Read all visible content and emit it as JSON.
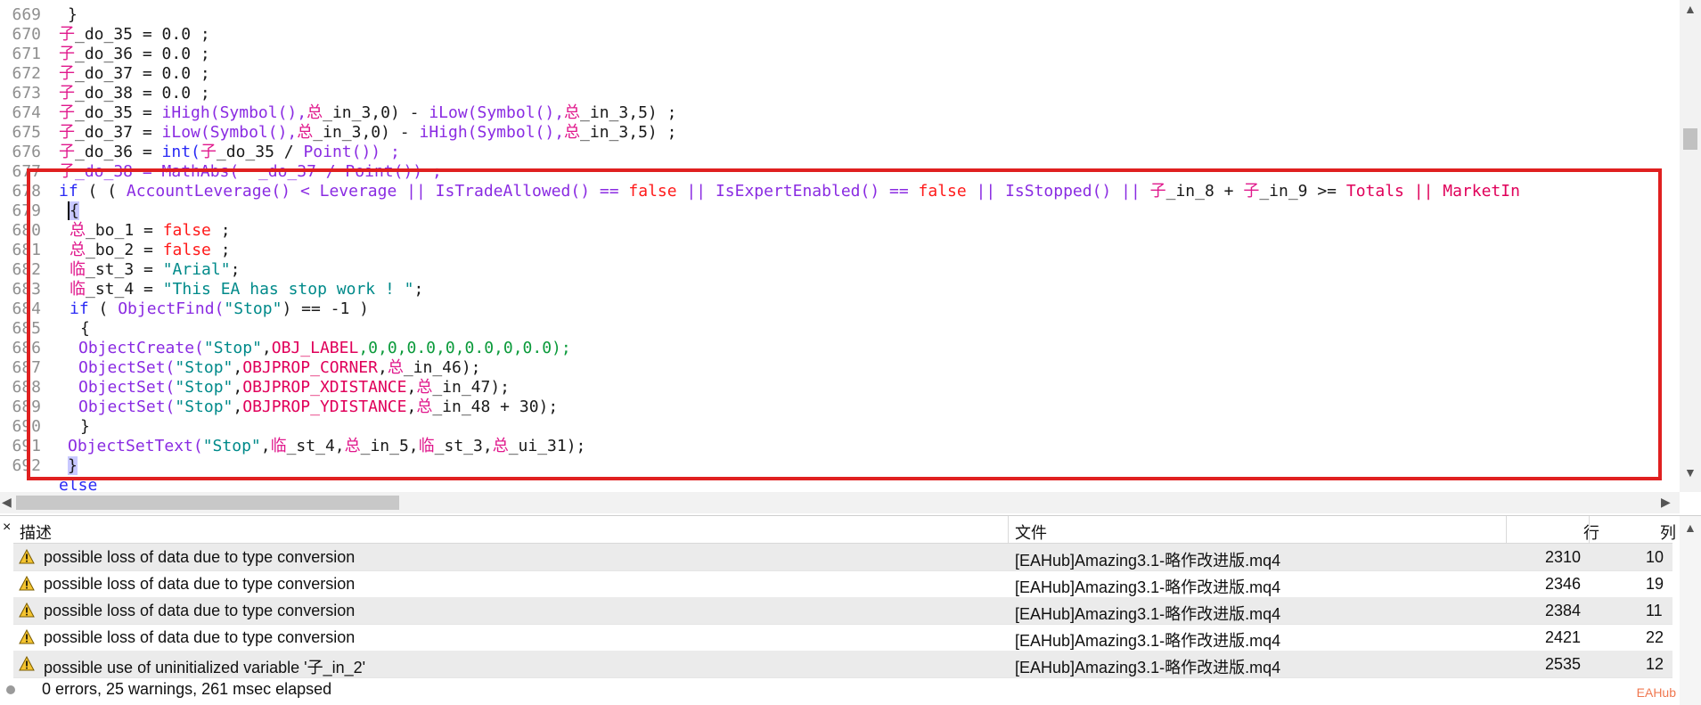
{
  "editor": {
    "lines": [
      {
        "num": "669"
      },
      {
        "num": "670"
      },
      {
        "num": "671"
      },
      {
        "num": "672"
      },
      {
        "num": "673"
      },
      {
        "num": "674"
      },
      {
        "num": "675"
      },
      {
        "num": "676"
      },
      {
        "num": "677"
      },
      {
        "num": "678"
      },
      {
        "num": "679"
      },
      {
        "num": "680"
      },
      {
        "num": "681"
      },
      {
        "num": "682"
      },
      {
        "num": "683"
      },
      {
        "num": "684"
      },
      {
        "num": "685"
      },
      {
        "num": "686"
      },
      {
        "num": "687"
      },
      {
        "num": "688"
      },
      {
        "num": "689"
      },
      {
        "num": "690"
      },
      {
        "num": "691"
      },
      {
        "num": "692"
      }
    ],
    "code": {
      "l669": "}",
      "l670": "_do_35 = 0.0 ;",
      "l671": "_do_36 = 0.0 ;",
      "l672": "_do_37 = 0.0 ;",
      "l673": "_do_38 = 0.0 ;",
      "l674_a": "_do_35 = ",
      "l674_b": "iHigh(Symbol(),",
      "l674_c": "_in_3,0) - ",
      "l674_d": "iLow(Symbol(),",
      "l674_e": "_in_3,5) ;",
      "l675_a": "_do_37 = ",
      "l675_b": "iLow(Symbol(),",
      "l675_c": "_in_3,0) - ",
      "l675_d": "iHigh(Symbol(),",
      "l675_e": "_in_3,5) ;",
      "l676_a": "_do_36 = ",
      "l676_b": "int(",
      "l676_c": "_do_35 / ",
      "l676_d": "Point()) ;",
      "l677": "_do_38 = MathAbs(  _do_37 / Point()) ;",
      "l678_if": "if",
      "l678_a": " ( ( ",
      "l678_b": "AccountLeverage() < Leverage || IsTradeAllowed() == ",
      "l678_false1": "false",
      "l678_c": " || IsExpertEnabled() == ",
      "l678_false2": "false",
      "l678_d": " || IsStopped() || ",
      "l678_e": "_in_8 + ",
      "l678_f": "_in_9 >= ",
      "l678_g": "Totals || MarketIn",
      "l679": "{",
      "l680_a": "_bo_1 = ",
      "l680_b": "false",
      "l680_c": " ;",
      "l681_a": "_bo_2 = ",
      "l681_b": "false",
      "l681_c": " ;",
      "l682_a": "_st_3 = ",
      "l682_b": "\"Arial\"",
      "l682_c": ";",
      "l683_a": "_st_4 = ",
      "l683_b": "\"This EA has stop work ! \"",
      "l683_c": ";",
      "l684_a": "if",
      "l684_b": " ( ",
      "l684_c": "ObjectFind(",
      "l684_d": "\"Stop\"",
      "l684_e": ") == -1 )",
      "l685": "{",
      "l686_a": "ObjectCreate(",
      "l686_b": "\"Stop\"",
      "l686_c": ",",
      "l686_d": "OBJ_LABEL",
      "l686_e": ",0,0,0.0,0,0.0,0,0.0);",
      "l687_a": "ObjectSet(",
      "l687_b": "\"Stop\"",
      "l687_c": ",",
      "l687_d": "OBJPROP_CORNER",
      "l687_e": ",",
      "l687_f": "_in_46);",
      "l688_a": "ObjectSet(",
      "l688_b": "\"Stop\"",
      "l688_c": ",",
      "l688_d": "OBJPROP_XDISTANCE",
      "l688_e": ",",
      "l688_f": "_in_47);",
      "l689_a": "ObjectSet(",
      "l689_b": "\"Stop\"",
      "l689_c": ",",
      "l689_d": "OBJPROP_YDISTANCE",
      "l689_e": ",",
      "l689_f": "_in_48 + 30);",
      "l690": "}",
      "l691_a": "ObjectSetText(",
      "l691_b": "\"Stop\"",
      "l691_c": ",",
      "l691_d": "_st_4,",
      "l691_e": "_in_5,",
      "l691_f": "_st_3,",
      "l691_g": "_ui_31);",
      "l692": "}",
      "l693": "else"
    },
    "zi": "子",
    "zong": "总",
    "lin": "临"
  },
  "errors_panel": {
    "close_glyph": "×",
    "headers": {
      "description": "描述",
      "file": "文件",
      "line": "行",
      "col": "列"
    },
    "rows": [
      {
        "desc": "possible loss of data due to type conversion",
        "file": "[EAHub]Amazing3.1-略作改进版.mq4",
        "line": "2310",
        "col": "10"
      },
      {
        "desc": "possible loss of data due to type conversion",
        "file": "[EAHub]Amazing3.1-略作改进版.mq4",
        "line": "2346",
        "col": "19"
      },
      {
        "desc": "possible loss of data due to type conversion",
        "file": "[EAHub]Amazing3.1-略作改进版.mq4",
        "line": "2384",
        "col": "11"
      },
      {
        "desc": "possible loss of data due to type conversion",
        "file": "[EAHub]Amazing3.1-略作改进版.mq4",
        "line": "2421",
        "col": "22"
      },
      {
        "desc": "possible use of uninitialized variable '子_in_2'",
        "file": "[EAHub]Amazing3.1-略作改进版.mq4",
        "line": "2535",
        "col": "12"
      }
    ],
    "status": "0 errors, 25 warnings, 261 msec elapsed",
    "watermark": "EAHub"
  },
  "colors": {
    "selection_box": "#e02020",
    "keyword": "#2a2af5",
    "function": "#8a2be2",
    "number": "#0a9a3a",
    "string": "#008a8a",
    "constant": "#e0005a",
    "boolean": "#ff1a1a"
  }
}
